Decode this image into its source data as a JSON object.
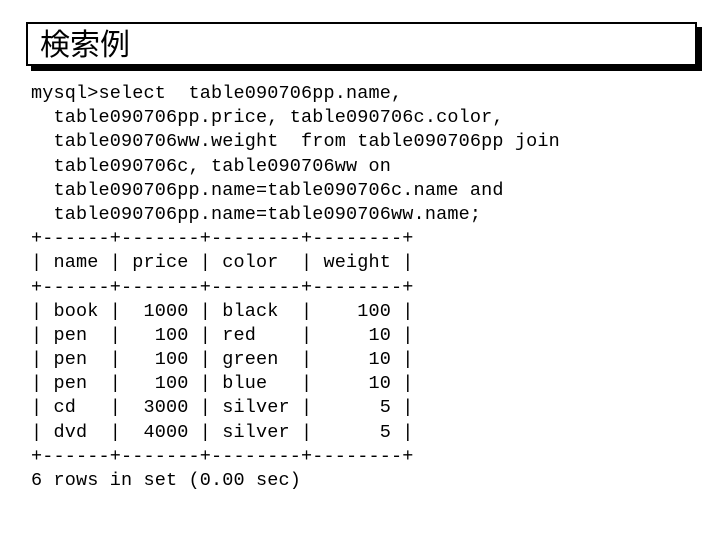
{
  "slide": {
    "title": "検索例",
    "background_color": "#ffffff",
    "text_color": "#000000",
    "title_border_color": "#000000",
    "title_shadow_color": "#000000"
  },
  "console": {
    "prompt": "mysql>",
    "query_lines": [
      "mysql>select  table090706pp.name,",
      "  table090706pp.price, table090706c.color,",
      "  table090706ww.weight  from table090706pp join",
      "  table090706c, table090706ww on",
      "  table090706pp.name=table090706c.name and",
      "  table090706pp.name=table090706ww.name;"
    ],
    "result_lines": [
      "+------+-------+--------+--------+",
      "| name | price | color  | weight |",
      "+------+-------+--------+--------+",
      "| book |  1000 | black  |    100 |",
      "| pen  |   100 | red    |     10 |",
      "| pen  |   100 | green  |     10 |",
      "| pen  |   100 | blue   |     10 |",
      "| cd   |  3000 | silver |      5 |",
      "| dvd  |  4000 | silver |      5 |",
      "+------+-------+--------+--------+",
      "6 rows in set (0.00 sec)"
    ],
    "footer": "6 rows in set (0.00 sec)",
    "row_count": "6",
    "elapsed": "0.00 sec"
  },
  "result_table": {
    "columns": [
      "name",
      "price",
      "color",
      "weight"
    ],
    "rows": [
      [
        "book",
        "1000",
        "black",
        "100"
      ],
      [
        "pen",
        "100",
        "red",
        "10"
      ],
      [
        "pen",
        "100",
        "green",
        "10"
      ],
      [
        "pen",
        "100",
        "blue",
        "10"
      ],
      [
        "cd",
        "3000",
        "silver",
        "5"
      ],
      [
        "dvd",
        "4000",
        "silver",
        "5"
      ]
    ]
  }
}
